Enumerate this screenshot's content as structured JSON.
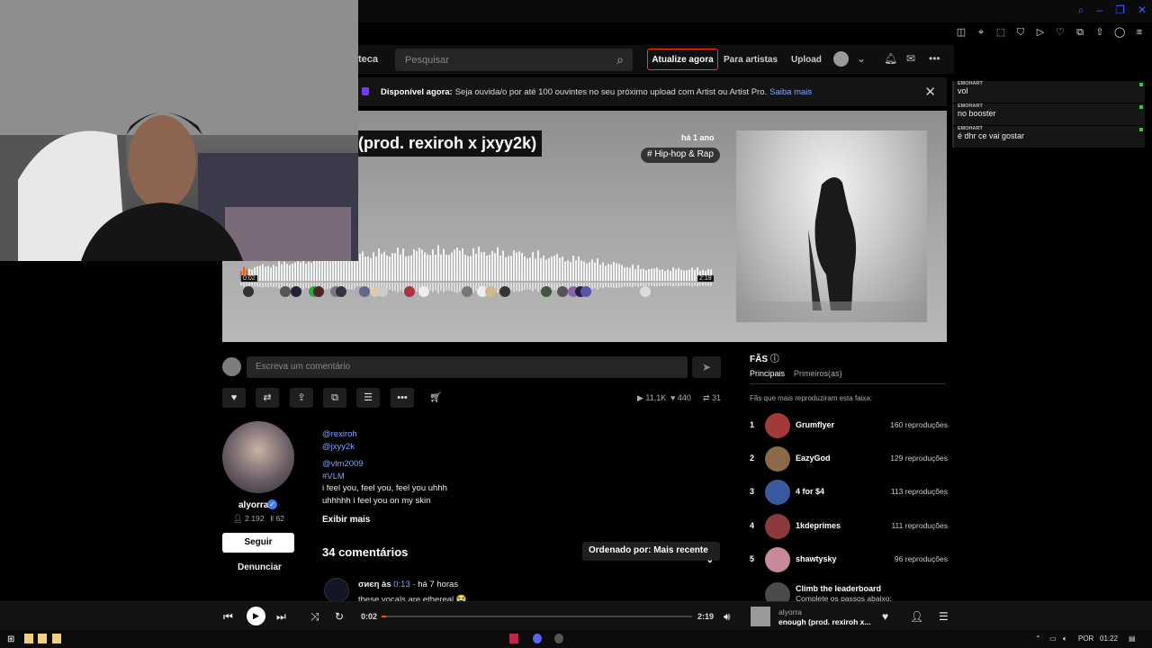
{
  "header": {
    "library_link": "teca",
    "search_placeholder": "Pesquisar",
    "upgrade_label": "Atualize agora",
    "for_artists_label": "Para artistas",
    "upload_label": "Upload"
  },
  "banner": {
    "bold": "Disponível agora:",
    "text": "Seja ouvida/o por até 100 ouvintes no seu próximo upload com Artist ou Artist Pro.",
    "link": "Saiba mais",
    "close": "✕"
  },
  "track": {
    "title": "(prod. rexiroh x jxyy2k)",
    "posted": "há 1 ano",
    "genre": "# Hip-hop & Rap",
    "wave_start": "0:02",
    "wave_end": "2:19",
    "progress": 0.015
  },
  "comment_box": {
    "placeholder": "Escreva um comentário"
  },
  "stats": {
    "plays": "11,1K",
    "likes": "440",
    "reposts": "31"
  },
  "uploader": {
    "name": "alyorra",
    "followers": "2.192",
    "tracks": "62",
    "follow_label": "Seguir",
    "report_label": "Denunciar"
  },
  "description": {
    "mention1": "@rexiroh",
    "mention2": "@jxyy2k",
    "mention3": "@vlm2009",
    "hashtag": "#VLM",
    "line1": "i feel you, feel you, feel you uhhh",
    "line2": "uhhhhh i feel you on my skin",
    "show_more": "Exibir mais"
  },
  "comments": {
    "title": "34 comentários",
    "sort_label": "Ordenado por: Mais recente",
    "first": {
      "user": "σиєη",
      "at_label": "às",
      "at_time": "0:13",
      "ago": "· há 7 horas",
      "text": "these vocals are ethereal 😭"
    }
  },
  "fans": {
    "title": "FÃS",
    "tab_main": "Principais",
    "tab_first": "Primeiros(as)",
    "subtitle": "Fãs que mais reproduziram esta faixa:",
    "list": [
      {
        "rank": "1",
        "name": "Grumflyer",
        "plays": "160 reproduções",
        "color": "#a33a3a"
      },
      {
        "rank": "2",
        "name": "EazyGod",
        "plays": "129 reproduções",
        "color": "#8a6a4a"
      },
      {
        "rank": "3",
        "name": "4 for $4",
        "plays": "113 reproduções",
        "color": "#3a5aa0"
      },
      {
        "rank": "4",
        "name": "1kdeprimes",
        "plays": "111 reproduções",
        "color": "#8a3a3a"
      },
      {
        "rank": "5",
        "name": "shawtysky",
        "plays": "96 reproduções",
        "color": "#c78a9a"
      }
    ],
    "climb_title": "Climb the leaderboard",
    "climb_sub": "Complete os passos abaixo:"
  },
  "chat": [
    {
      "user": "EMOHART",
      "text": "vol"
    },
    {
      "user": "EMOHART",
      "text": "no booster"
    },
    {
      "user": "EMOHART",
      "text": "é dhr ce vai gostar"
    }
  ],
  "player": {
    "current": "0:02",
    "total": "2:19",
    "artist": "alyorra",
    "title": "enough (prod. rexiroh x..."
  },
  "taskbar": {
    "lang": "POR",
    "time": "01:22"
  },
  "colors": {
    "accent": "#ff5500",
    "upgrade_border": "#ff3a16",
    "link": "#7fa4ff"
  }
}
